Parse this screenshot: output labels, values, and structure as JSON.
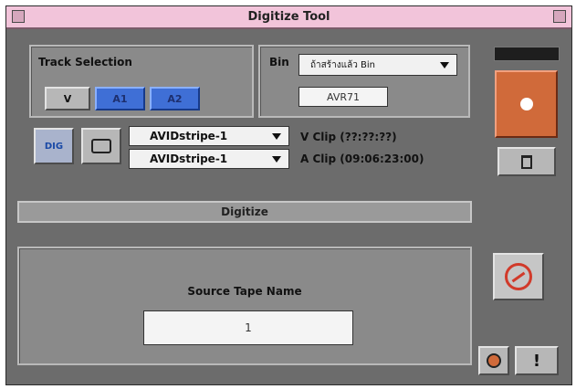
{
  "window": {
    "title": "Digitize Tool"
  },
  "track_selection": {
    "label": "Track Selection",
    "buttons": [
      "V",
      "A1",
      "A2"
    ]
  },
  "bin": {
    "label": "Bin",
    "selected": "ถ้าสร้างแล้ว Bin",
    "field_value": "AVR71"
  },
  "clips": {
    "left_buttons": [
      "DIG",
      ""
    ],
    "video_source": "AVIDstripe-1",
    "audio_source": "AVIDstripe-1",
    "v_clip_label": "V Clip (??:??:??)",
    "a_clip_label": "A Clip (09:06:23:00)"
  },
  "digitize": {
    "label": "Digitize"
  },
  "source_tape": {
    "label": "Source Tape Name",
    "value": "1"
  },
  "colors": {
    "title_bg": "#f2c4da",
    "record_button": "#d06a3a",
    "selected_tracks": "#3f6fd6"
  },
  "icons": [
    "trash-icon",
    "no-audio-icon",
    "info-icon",
    "alert-icon",
    "record-icon"
  ]
}
